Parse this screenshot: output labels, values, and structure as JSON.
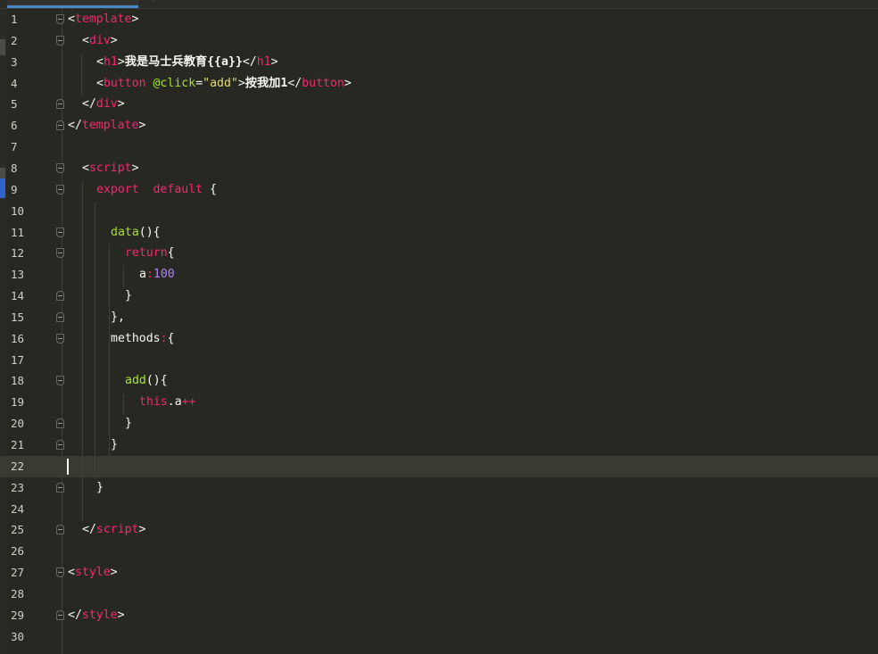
{
  "editor": {
    "current_line": 22,
    "lines": [
      {
        "n": "1",
        "fold": "open",
        "indent": 0,
        "tokens": [
          {
            "c": "t-p",
            "t": "<"
          },
          {
            "c": "t-tag",
            "t": "template"
          },
          {
            "c": "t-p",
            "t": ">"
          }
        ]
      },
      {
        "n": "2",
        "fold": "open",
        "indent": 1,
        "tokens": [
          {
            "c": "t-p",
            "t": "<"
          },
          {
            "c": "t-tag",
            "t": "div"
          },
          {
            "c": "t-p",
            "t": ">"
          }
        ]
      },
      {
        "n": "3",
        "fold": "",
        "indent": 2,
        "tokens": [
          {
            "c": "t-p",
            "t": "<"
          },
          {
            "c": "t-tag",
            "t": "h1"
          },
          {
            "c": "t-p",
            "t": ">"
          },
          {
            "c": "t-cn",
            "t": "我是马士兵教育{{a}}"
          },
          {
            "c": "t-p",
            "t": "</"
          },
          {
            "c": "t-tag",
            "t": "h1"
          },
          {
            "c": "t-p",
            "t": ">"
          }
        ]
      },
      {
        "n": "4",
        "fold": "",
        "indent": 2,
        "tokens": [
          {
            "c": "t-p",
            "t": "<"
          },
          {
            "c": "t-tag",
            "t": "button"
          },
          {
            "c": "t-p",
            "t": " "
          },
          {
            "c": "t-attr",
            "t": "@click"
          },
          {
            "c": "t-p",
            "t": "="
          },
          {
            "c": "t-str",
            "t": "\"add\""
          },
          {
            "c": "t-p",
            "t": ">"
          },
          {
            "c": "t-cn",
            "t": "按我加1"
          },
          {
            "c": "t-p",
            "t": "</"
          },
          {
            "c": "t-tag",
            "t": "button"
          },
          {
            "c": "t-p",
            "t": ">"
          }
        ]
      },
      {
        "n": "5",
        "fold": "close",
        "indent": 1,
        "tokens": [
          {
            "c": "t-p",
            "t": "</"
          },
          {
            "c": "t-tag",
            "t": "div"
          },
          {
            "c": "t-p",
            "t": ">"
          }
        ]
      },
      {
        "n": "6",
        "fold": "close",
        "indent": 0,
        "tokens": [
          {
            "c": "t-p",
            "t": "</"
          },
          {
            "c": "t-tag",
            "t": "template"
          },
          {
            "c": "t-p",
            "t": ">"
          }
        ]
      },
      {
        "n": "7",
        "fold": "",
        "indent": 0,
        "tokens": []
      },
      {
        "n": "8",
        "fold": "open",
        "indent": 1,
        "tokens": [
          {
            "c": "t-p",
            "t": "<"
          },
          {
            "c": "t-tag",
            "t": "script"
          },
          {
            "c": "t-p",
            "t": ">"
          }
        ]
      },
      {
        "n": "9",
        "fold": "open",
        "indent": 2,
        "tokens": [
          {
            "c": "t-kw",
            "t": "export  default "
          },
          {
            "c": "t-p",
            "t": "{"
          }
        ]
      },
      {
        "n": "10",
        "fold": "",
        "indent": 0,
        "tokens": []
      },
      {
        "n": "11",
        "fold": "open",
        "indent": 3,
        "tokens": [
          {
            "c": "t-fn",
            "t": "data"
          },
          {
            "c": "t-p",
            "t": "(){"
          }
        ]
      },
      {
        "n": "12",
        "fold": "open",
        "indent": 4,
        "tokens": [
          {
            "c": "t-kw",
            "t": "return"
          },
          {
            "c": "t-p",
            "t": "{"
          }
        ]
      },
      {
        "n": "13",
        "fold": "",
        "indent": 5,
        "tokens": [
          {
            "c": "t-p",
            "t": "a"
          },
          {
            "c": "t-kw",
            "t": ":"
          },
          {
            "c": "t-num",
            "t": "100"
          }
        ]
      },
      {
        "n": "14",
        "fold": "close",
        "indent": 4,
        "tokens": [
          {
            "c": "t-p",
            "t": "}"
          }
        ]
      },
      {
        "n": "15",
        "fold": "close",
        "indent": 3,
        "tokens": [
          {
            "c": "t-p",
            "t": "},"
          }
        ]
      },
      {
        "n": "16",
        "fold": "open",
        "indent": 3,
        "tokens": [
          {
            "c": "t-p",
            "t": "methods"
          },
          {
            "c": "t-kw",
            "t": ":"
          },
          {
            "c": "t-p",
            "t": "{"
          }
        ]
      },
      {
        "n": "17",
        "fold": "",
        "indent": 0,
        "tokens": []
      },
      {
        "n": "18",
        "fold": "open",
        "indent": 4,
        "tokens": [
          {
            "c": "t-fn",
            "t": "add"
          },
          {
            "c": "t-p",
            "t": "(){"
          }
        ]
      },
      {
        "n": "19",
        "fold": "",
        "indent": 5,
        "tokens": [
          {
            "c": "t-kw",
            "t": "this"
          },
          {
            "c": "t-p",
            "t": ".a"
          },
          {
            "c": "t-kw",
            "t": "++"
          }
        ]
      },
      {
        "n": "20",
        "fold": "close",
        "indent": 4,
        "tokens": [
          {
            "c": "t-p",
            "t": "}"
          }
        ]
      },
      {
        "n": "21",
        "fold": "close",
        "indent": 3,
        "tokens": [
          {
            "c": "t-p",
            "t": "}"
          }
        ]
      },
      {
        "n": "22",
        "fold": "",
        "indent": 0,
        "tokens": []
      },
      {
        "n": "23",
        "fold": "close",
        "indent": 2,
        "tokens": [
          {
            "c": "t-p",
            "t": "}"
          }
        ]
      },
      {
        "n": "24",
        "fold": "",
        "indent": 0,
        "tokens": []
      },
      {
        "n": "25",
        "fold": "close",
        "indent": 1,
        "tokens": [
          {
            "c": "t-p",
            "t": "</"
          },
          {
            "c": "t-tag",
            "t": "script"
          },
          {
            "c": "t-p",
            "t": ">"
          }
        ]
      },
      {
        "n": "26",
        "fold": "",
        "indent": 0,
        "tokens": []
      },
      {
        "n": "27",
        "fold": "open",
        "indent": 0,
        "tokens": [
          {
            "c": "t-p",
            "t": "<"
          },
          {
            "c": "t-tag",
            "t": "style"
          },
          {
            "c": "t-p",
            "t": ">"
          }
        ]
      },
      {
        "n": "28",
        "fold": "",
        "indent": 0,
        "tokens": []
      },
      {
        "n": "29",
        "fold": "close",
        "indent": 0,
        "tokens": [
          {
            "c": "t-p",
            "t": "</"
          },
          {
            "c": "t-tag",
            "t": "style"
          },
          {
            "c": "t-p",
            "t": ">"
          }
        ]
      },
      {
        "n": "30",
        "fold": "",
        "indent": 0,
        "tokens": []
      }
    ]
  },
  "colors": {
    "background": "#272822",
    "tag": "#f92672",
    "string": "#e6db74",
    "function": "#a6e22e",
    "number": "#ae81ff",
    "text": "#f8f8f2",
    "current_line": "#3a3a30",
    "active_tab_underline": "#4a88c7"
  }
}
